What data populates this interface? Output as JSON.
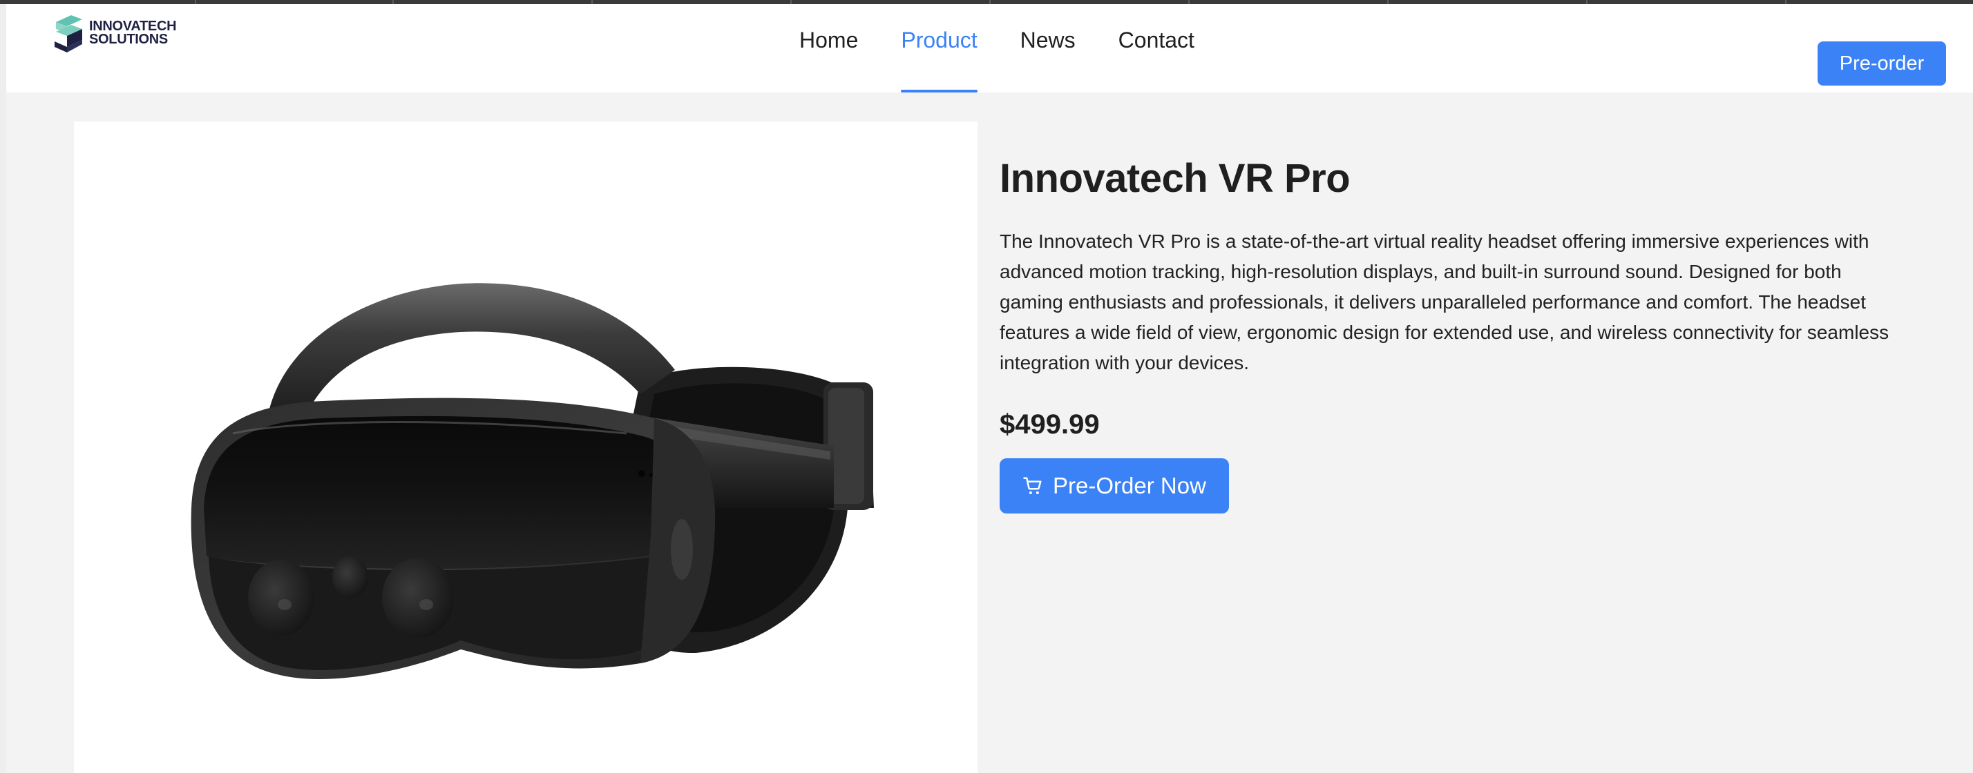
{
  "logo": {
    "line1": "INNOVATECH",
    "line2": "SOLUTIONS",
    "icon": "logo-s-mark"
  },
  "nav": {
    "items": [
      {
        "label": "Home",
        "active": false
      },
      {
        "label": "Product",
        "active": true
      },
      {
        "label": "News",
        "active": false
      },
      {
        "label": "Contact",
        "active": false
      }
    ],
    "accent_color": "#3b82f6"
  },
  "header": {
    "preorder_label": "Pre-order"
  },
  "product": {
    "title": "Innovatech VR Pro",
    "description": "The Innovatech VR Pro is a state-of-the-art virtual reality headset offering immersive experiences with advanced motion tracking, high-resolution displays, and built-in surround sound. Designed for both gaming enthusiasts and professionals, it delivers unparalleled performance and comfort. The headset features a wide field of view, ergonomic design for extended use, and wireless connectivity for seamless integration with your devices.",
    "price": "$499.99",
    "cta_label": "Pre-Order Now",
    "cta_icon": "cart-icon",
    "image": "vr-headset-image"
  }
}
